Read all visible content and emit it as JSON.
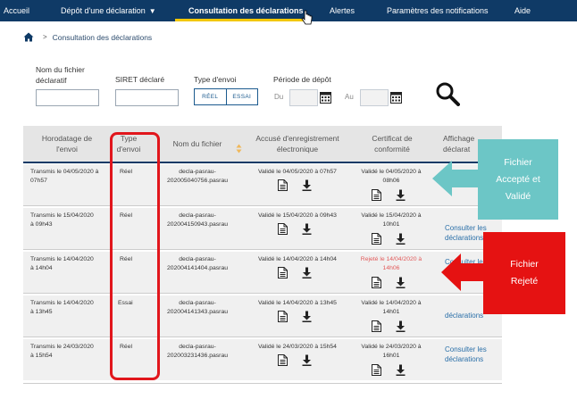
{
  "nav": {
    "items": [
      "Accueil",
      "Dépôt d'une déclaration",
      "Consultation des déclarations",
      "Alertes",
      "Paramètres des notifications",
      "Aide"
    ],
    "caret": "▼"
  },
  "breadcrumb": {
    "separator": ">",
    "current": "Consultation des déclarations"
  },
  "filters": {
    "nom_fichier_label_1": "Nom du fichier",
    "nom_fichier_label_2": "déclaratif",
    "siret_label": "SIRET déclaré",
    "type_envoi_label": "Type d'envoi",
    "type_options": [
      "RÉEL",
      "ESSAI"
    ],
    "periode_label": "Période de dépôt",
    "du_label": "Du",
    "au_label": "Au"
  },
  "table": {
    "headers": {
      "horodatage_1": "Horodatage de",
      "horodatage_2": "l'envoi",
      "type_1": "Type",
      "type_2": "d'envoi",
      "nom": "Nom du fichier",
      "accuse_1": "Accusé d'enregistrement",
      "accuse_2": "électronique",
      "certificat_1": "Certificat de",
      "certificat_2": "conformité",
      "affichage_1": "Affichage",
      "affichage_2": "déclarat"
    },
    "rows": [
      {
        "horodatage_1": "Transmis le 04/05/2020 à",
        "horodatage_2": "07h57",
        "type": "Réel",
        "nom_1": "decla-pasrau-",
        "nom_2": "202005040756.pasrau",
        "accuse": "Validé le 04/05/2020 à 07h57",
        "cert_1": "Validé le 04/05/2020 à",
        "cert_2": "08h06",
        "cert_status": "ok",
        "link_1": "",
        "link_2": ""
      },
      {
        "horodatage_1": "Transmis le 15/04/2020",
        "horodatage_2": "à 09h43",
        "type": "Réel",
        "nom_1": "decla-pasrau-",
        "nom_2": "202004150943.pasrau",
        "accuse": "Validé le 15/04/2020 à 09h43",
        "cert_1": "Validé le 15/04/2020 à",
        "cert_2": "10h01",
        "cert_status": "ok",
        "link_1": "Consulter les",
        "link_2": "déclarations"
      },
      {
        "horodatage_1": "Transmis le 14/04/2020",
        "horodatage_2": "à 14h04",
        "type": "Réel",
        "nom_1": "decla-pasrau-",
        "nom_2": "202004141404.pasrau",
        "accuse": "Validé le 14/04/2020 à 14h04",
        "cert_1": "Rejeté le 14/04/2020 à",
        "cert_2": "14h06",
        "cert_status": "rejected",
        "link_1": "Consulter le",
        "link_2": ""
      },
      {
        "horodatage_1": "Transmis le 14/04/2020",
        "horodatage_2": "à 13h45",
        "type": "Essai",
        "nom_1": "decla-pasrau-",
        "nom_2": "202004141343.pasrau",
        "accuse": "Validé le 14/04/2020 à 13h45",
        "cert_1": "Validé le 14/04/2020 à",
        "cert_2": "14h01",
        "cert_status": "ok",
        "link_1": "",
        "link_2": "déclarations"
      },
      {
        "horodatage_1": "Transmis le 24/03/2020",
        "horodatage_2": "à 15h54",
        "type": "Réel",
        "nom_1": "decla-pasrau-",
        "nom_2": "202003231436.pasrau",
        "accuse": "Validé le 24/03/2020 à 15h54",
        "cert_1": "Validé le 24/03/2020 à",
        "cert_2": "16h01",
        "cert_status": "ok",
        "link_1": "Consulter les",
        "link_2": "déclarations"
      }
    ]
  },
  "callouts": {
    "accepte_1": "Fichier",
    "accepte_2": "Accepté et",
    "accepte_3": "Validé",
    "rejete_1": "Fichier",
    "rejete_2": "Rejeté"
  },
  "colors": {
    "nav_bg": "#0f3a66",
    "nav_active_underline": "#f2c700",
    "link": "#2a6fa8",
    "rejected_text": "#e25a5a",
    "highlight_frame": "#e1161c",
    "callout_teal": "#6cc6c6",
    "callout_red": "#e51212"
  },
  "icons": [
    "home-icon",
    "calendar-icon",
    "search-icon",
    "sort-icon",
    "document-icon",
    "download-icon",
    "mouse-pointer-icon"
  ]
}
